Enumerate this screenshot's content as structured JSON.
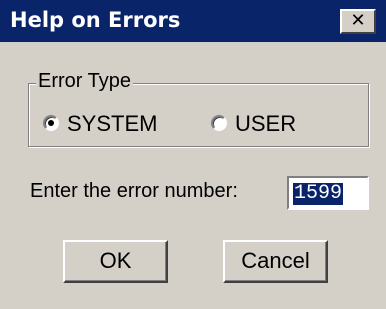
{
  "window": {
    "title": "Help on Errors",
    "close_glyph": "✕",
    "close_icon": "close-icon"
  },
  "error_type": {
    "legend": "Error Type",
    "options": [
      {
        "label": "SYSTEM",
        "selected": true
      },
      {
        "label": "USER",
        "selected": false
      }
    ]
  },
  "input": {
    "prompt": "Enter the error number:",
    "value": "1599"
  },
  "buttons": {
    "ok": "OK",
    "cancel": "Cancel"
  },
  "colors": {
    "titlebar": "#0a246a",
    "face": "#d4d0c8",
    "selection": "#0a246a"
  }
}
